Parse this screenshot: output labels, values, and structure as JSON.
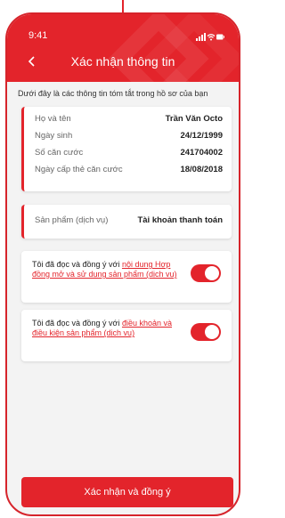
{
  "status_bar": {
    "time": "9:41"
  },
  "header": {
    "title": "Xác nhận thông tin"
  },
  "subtitle": "Dưới đây là các thông tin tóm tắt trong hồ sơ của bạn",
  "info": [
    {
      "label": "Họ và tên",
      "value": "Trần Văn Octo"
    },
    {
      "label": "Ngày sinh",
      "value": "24/12/1999"
    },
    {
      "label": "Số căn cước",
      "value": "241704002"
    },
    {
      "label": "Ngày cấp thẻ căn cước",
      "value": "18/08/2018"
    }
  ],
  "product": {
    "label": "Sản phẩm (dịch vụ)",
    "value": "Tài khoản thanh toán"
  },
  "agreements": [
    {
      "prefix": "Tôi đã đọc và đồng ý với ",
      "link": "nội dung Hợp đồng mở và sử dụng sản phẩm (dịch vụ)",
      "enabled": true
    },
    {
      "prefix": "Tôi đã đọc và đồng ý với ",
      "link": "điều khoản và điều kiện sản phẩm (dịch vụ)",
      "enabled": true
    }
  ],
  "primary_button": "Xác nhận và đồng ý",
  "colors": {
    "accent": "#e3242b",
    "background": "#f3f3f3"
  },
  "icons": [
    "back-chevron-icon",
    "signal-icon",
    "wifi-icon",
    "battery-icon"
  ]
}
